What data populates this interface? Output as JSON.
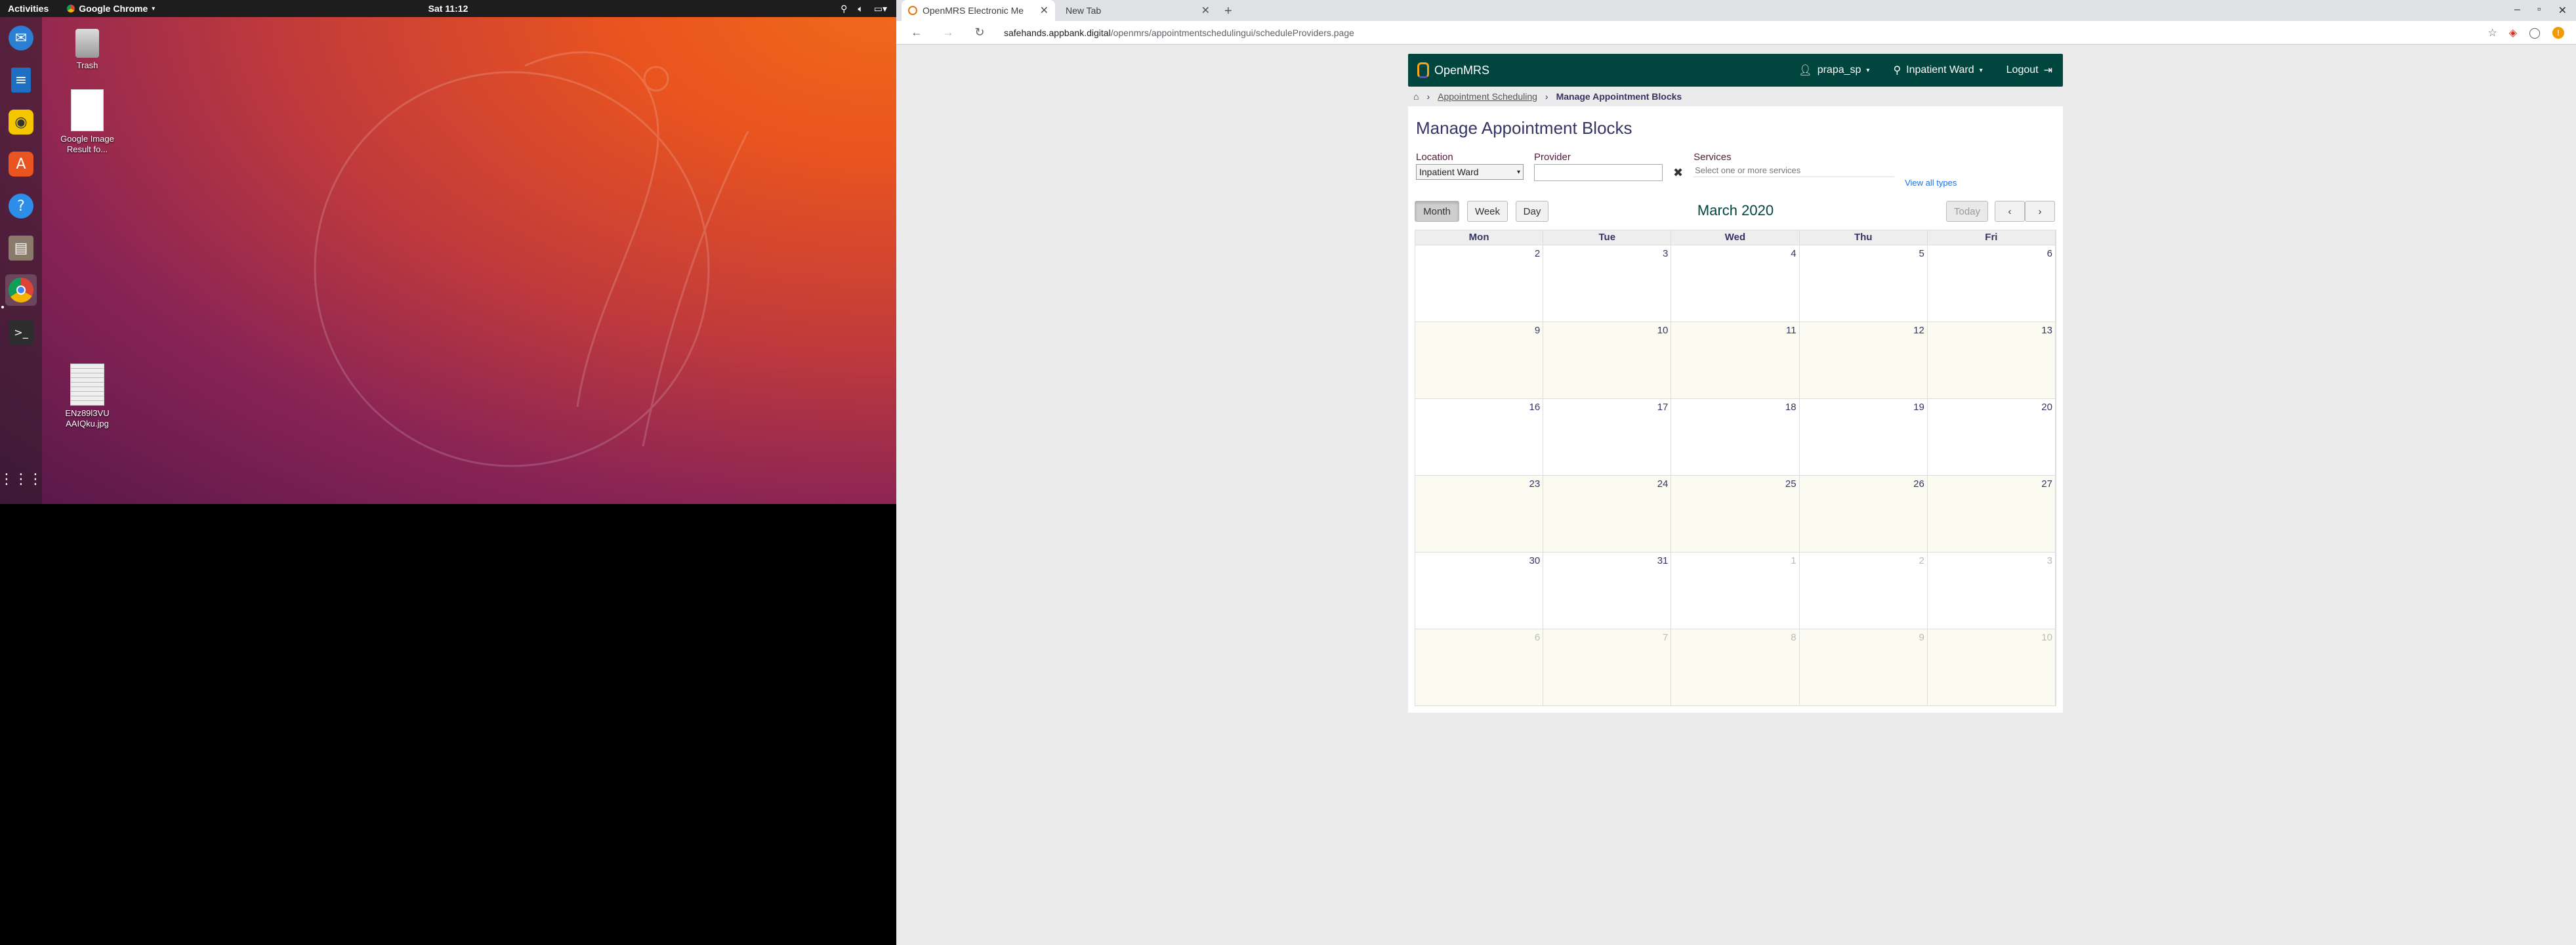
{
  "desktop": {
    "topbar": {
      "activities": "Activities",
      "app_menu": "Google Chrome",
      "clock": "Sat 11:12"
    },
    "icons": [
      {
        "label": "Trash"
      },
      {
        "label": "Google Image Result fo..."
      },
      {
        "label": "ENz89l3VU AAIQku.jpg"
      }
    ],
    "dock": [
      "thunderbird-icon",
      "libreoffice-writer-icon",
      "rhythmbox-icon",
      "software-center-icon",
      "help-icon",
      "files-icon",
      "chrome-icon",
      "terminal-icon",
      "app-grid-icon"
    ]
  },
  "browser": {
    "tabs": [
      {
        "label": "OpenMRS Electronic Me"
      },
      {
        "label": "New Tab"
      }
    ],
    "url_host": "safehands.appbank.digital",
    "url_path": "/openmrs/appointmentschedulingui/scheduleProviders.page"
  },
  "app": {
    "logo": "OpenMRS",
    "user": "prapa_sp",
    "location": "Inpatient Ward",
    "logout": "Logout",
    "breadcrumb": {
      "link": "Appointment Scheduling",
      "current": "Manage Appointment Blocks"
    },
    "title": "Manage Appointment Blocks",
    "filters": {
      "location_label": "Location",
      "location_value": "Inpatient Ward",
      "provider_label": "Provider",
      "services_label": "Services",
      "services_placeholder": "Select one or more services",
      "view_all": "View all types"
    },
    "calendar": {
      "buttons": {
        "month": "Month",
        "week": "Week",
        "day": "Day",
        "today": "Today"
      },
      "title": "March 2020",
      "weekdays": [
        "Mon",
        "Tue",
        "Wed",
        "Thu",
        "Fri"
      ],
      "weeks": [
        [
          "2",
          "3",
          "4",
          "5",
          "6"
        ],
        [
          "9",
          "10",
          "11",
          "12",
          "13"
        ],
        [
          "16",
          "17",
          "18",
          "19",
          "20"
        ],
        [
          "23",
          "24",
          "25",
          "26",
          "27"
        ],
        [
          "30",
          "31",
          "1",
          "2",
          "3"
        ],
        [
          "6",
          "7",
          "8",
          "9",
          "10"
        ]
      ]
    }
  }
}
